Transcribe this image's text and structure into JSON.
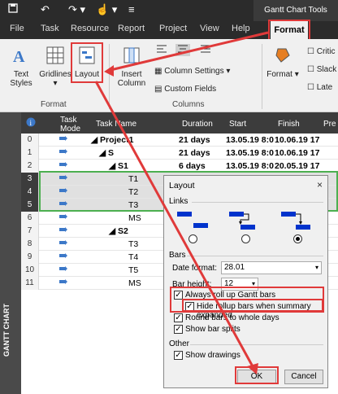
{
  "titlebar": {
    "context_title": "Gantt Chart Tools"
  },
  "tabs": [
    "File",
    "Task",
    "Resource",
    "Report",
    "Project",
    "View",
    "Help",
    "Format"
  ],
  "ribbon": {
    "text_styles": "Text Styles",
    "gridlines": "Gridlines",
    "layout": "Layout",
    "insert_column": "Insert Column",
    "column_settings": "Column Settings",
    "custom_fields": "Custom Fields",
    "format_label": "Format",
    "group_format": "Format",
    "group_columns": "Columns",
    "format_btn": "Format",
    "crit": "Critic",
    "slack": "Slack",
    "late": "Late"
  },
  "grid": {
    "headers": {
      "mode": "Task Mode",
      "name": "Task Name",
      "duration": "Duration",
      "start": "Start",
      "finish": "Finish",
      "pred": "Pre"
    },
    "rows": [
      {
        "id": "0",
        "name": "Project1",
        "duration": "21 days",
        "start": "13.05.19 8:0",
        "finish": "10.06.19 17"
      },
      {
        "id": "1",
        "name": "S",
        "duration": "21 days",
        "start": "13.05.19 8:0",
        "finish": "10.06.19 17"
      },
      {
        "id": "2",
        "name": "S1",
        "duration": "6 days",
        "start": "13.05.19 8:0",
        "finish": "20.05.19 17"
      },
      {
        "id": "3",
        "name": "T1",
        "duration": "",
        "start": "",
        "finish": ""
      },
      {
        "id": "4",
        "name": "T2",
        "duration": "",
        "start": "",
        "finish": ""
      },
      {
        "id": "5",
        "name": "T3",
        "duration": "",
        "start": "",
        "finish": ""
      },
      {
        "id": "6",
        "name": "MS",
        "duration": "",
        "start": "",
        "finish": ""
      },
      {
        "id": "7",
        "name": "S2",
        "duration": "",
        "start": "",
        "finish": ""
      },
      {
        "id": "8",
        "name": "T3",
        "duration": "",
        "start": "",
        "finish": ""
      },
      {
        "id": "9",
        "name": "T4",
        "duration": "",
        "start": "",
        "finish": ""
      },
      {
        "id": "10",
        "name": "T5",
        "duration": "",
        "start": "",
        "finish": ""
      },
      {
        "id": "11",
        "name": "MS",
        "duration": "",
        "start": "",
        "finish": ""
      }
    ]
  },
  "sidebar": {
    "label": "GANTT CHART"
  },
  "dialog": {
    "title": "Layout",
    "close": "×",
    "links": "Links",
    "bars": "Bars",
    "date_format_label": "Date format:",
    "date_format_value": "28.01",
    "bar_height_label": "Bar height:",
    "bar_height_value": "12",
    "always_rollup": "Always roll up Gantt bars",
    "hide_rollup": "Hide rollup bars when summary expanded",
    "round_bars": "Round bars to whole days",
    "show_splits": "Show bar splits",
    "other": "Other",
    "show_drawings": "Show drawings",
    "ok": "OK",
    "cancel": "Cancel"
  }
}
